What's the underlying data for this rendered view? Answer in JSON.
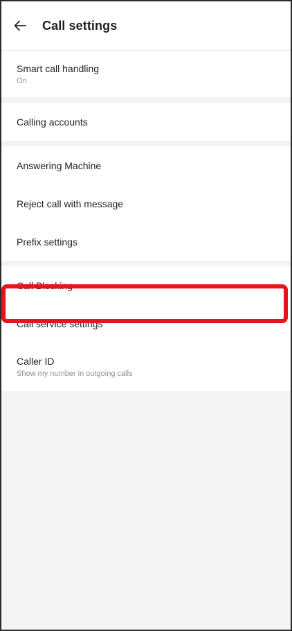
{
  "header": {
    "title": "Call settings",
    "back_icon": "arrow-left-icon"
  },
  "settings": {
    "smart_call_handling": {
      "label": "Smart call handling",
      "value": "On"
    },
    "calling_accounts": {
      "label": "Calling accounts"
    },
    "answering_machine": {
      "label": "Answering Machine"
    },
    "reject_call_with_message": {
      "label": "Reject call with message"
    },
    "prefix_settings": {
      "label": "Prefix settings"
    },
    "call_blocking": {
      "label": "Call Blocking"
    },
    "call_service_settings": {
      "label": "Call service settings"
    },
    "caller_id": {
      "label": "Caller ID",
      "value": "Show my number in outgoing calls"
    }
  },
  "highlight_color": "#e8141b"
}
